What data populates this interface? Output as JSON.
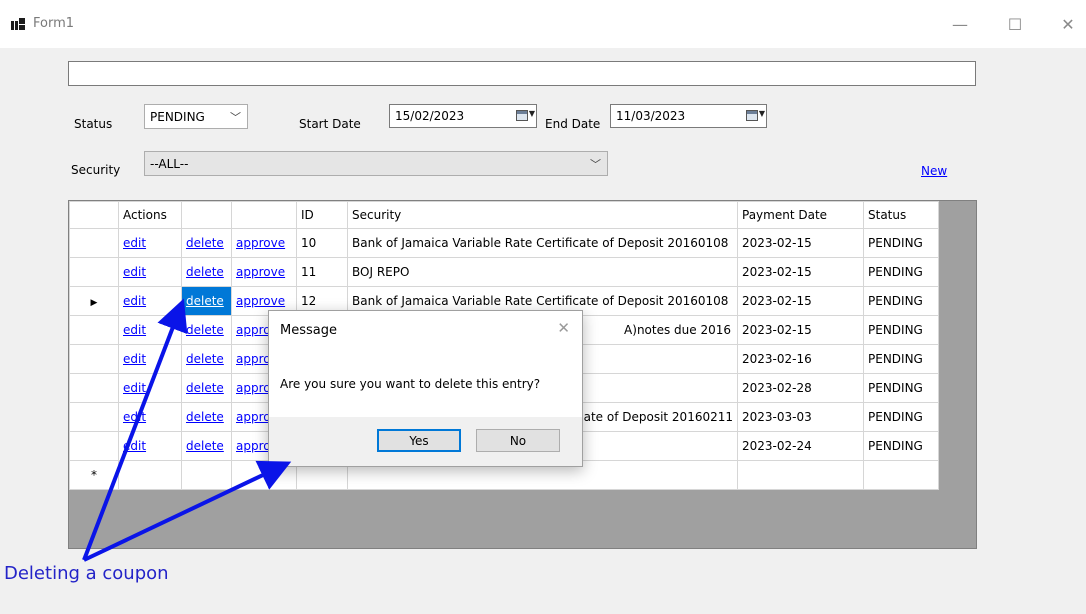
{
  "window": {
    "title": "Form1",
    "minimize": "—",
    "maximize": "☐",
    "close": "✕"
  },
  "search": {
    "value": ""
  },
  "filters": {
    "status_label": "Status",
    "status_value": "PENDING",
    "start_date_label": "Start Date",
    "start_date_value": "15/02/2023",
    "end_date_label": "End Date",
    "end_date_value": "11/03/2023",
    "security_label": "Security",
    "security_value": "--ALL--",
    "new_link": "New"
  },
  "grid": {
    "headers": [
      "Actions",
      "",
      "",
      "ID",
      "Security",
      "Payment Date",
      "Status"
    ],
    "rows": [
      {
        "edit": "edit",
        "delete": "delete",
        "approve": "approve",
        "id": "10",
        "security": "Bank of Jamaica Variable Rate Certificate of Deposit 20160108",
        "payment_date": "2023-02-15",
        "status": "PENDING"
      },
      {
        "edit": "edit",
        "delete": "delete",
        "approve": "approve",
        "id": "11",
        "security": "BOJ REPO",
        "payment_date": "2023-02-15",
        "status": "PENDING"
      },
      {
        "edit": "edit",
        "delete": "delete",
        "approve": "approve",
        "id": "12",
        "security": "Bank of Jamaica Variable Rate Certificate of Deposit 20160108",
        "payment_date": "2023-02-15",
        "status": "PENDING"
      },
      {
        "edit": "edit",
        "delete": "delete",
        "approve": "appro",
        "id": "",
        "security": "A)notes due 2016",
        "payment_date": "2023-02-15",
        "status": "PENDING"
      },
      {
        "edit": "edit",
        "delete": "delete",
        "approve": "appro",
        "id": "",
        "security": "",
        "payment_date": "2023-02-16",
        "status": "PENDING"
      },
      {
        "edit": "edit",
        "delete": "delete",
        "approve": "appro",
        "id": "",
        "security": "",
        "payment_date": "2023-02-28",
        "status": "PENDING"
      },
      {
        "edit": "edit",
        "delete": "delete",
        "approve": "appro",
        "id": "",
        "security": "ate of Deposit 20160211",
        "payment_date": "2023-03-03",
        "status": "PENDING"
      },
      {
        "edit": "edit",
        "delete": "delete",
        "approve": "appro",
        "id": "",
        "security": "",
        "payment_date": "2023-02-24",
        "status": "PENDING"
      }
    ],
    "current_row_marker": "▶",
    "new_row_marker": "*"
  },
  "dialog": {
    "title": "Message",
    "message": "Are you sure you want to delete this entry?",
    "yes": "Yes",
    "no": "No",
    "close": "✕"
  },
  "annotation": {
    "caption": "Deleting a coupon",
    "color": "#0a14e8"
  }
}
